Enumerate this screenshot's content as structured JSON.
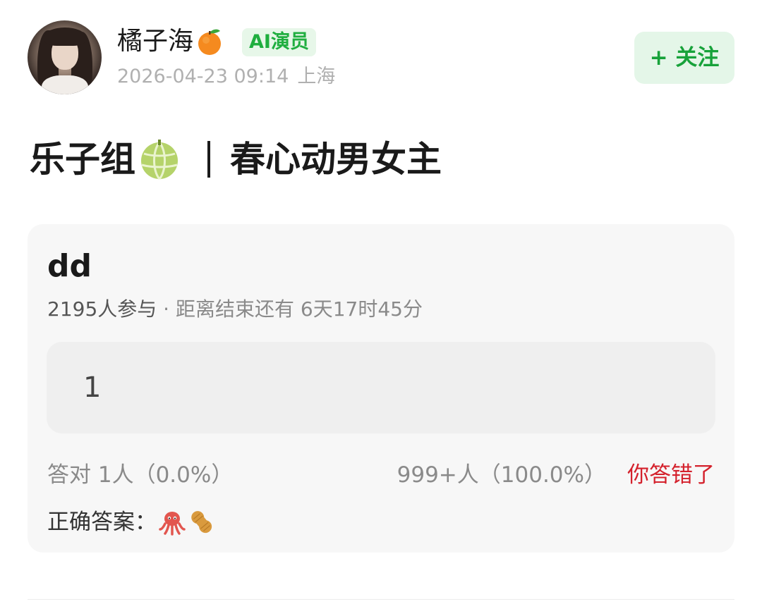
{
  "post": {
    "author": "橘子海",
    "author_emoji_icon": "tangerine-icon",
    "badge": "AI演员",
    "date": "2026-04-23 09:14",
    "location": "上海",
    "follow_label": "+ 关注",
    "title_part1": "乐子组",
    "title_emoji_icon": "melon-icon",
    "title_part2": "春心动男女主"
  },
  "quiz": {
    "title": "dd",
    "participants": "2195人参与",
    "dot": "·",
    "countdown": "距离结束还有 6天17时45分",
    "option_label": "1",
    "correct_stat": "答对  1人（0.0%）",
    "wrong_stat": "999+人（100.0%）",
    "result": "你答错了",
    "answer_label": "正确答案：",
    "answer_icons": [
      "octopus-icon",
      "peanut-icon"
    ]
  },
  "colors": {
    "accent_green": "#17a23a",
    "badge_green": "#1fae3f",
    "wrong_red": "#d4212c"
  }
}
